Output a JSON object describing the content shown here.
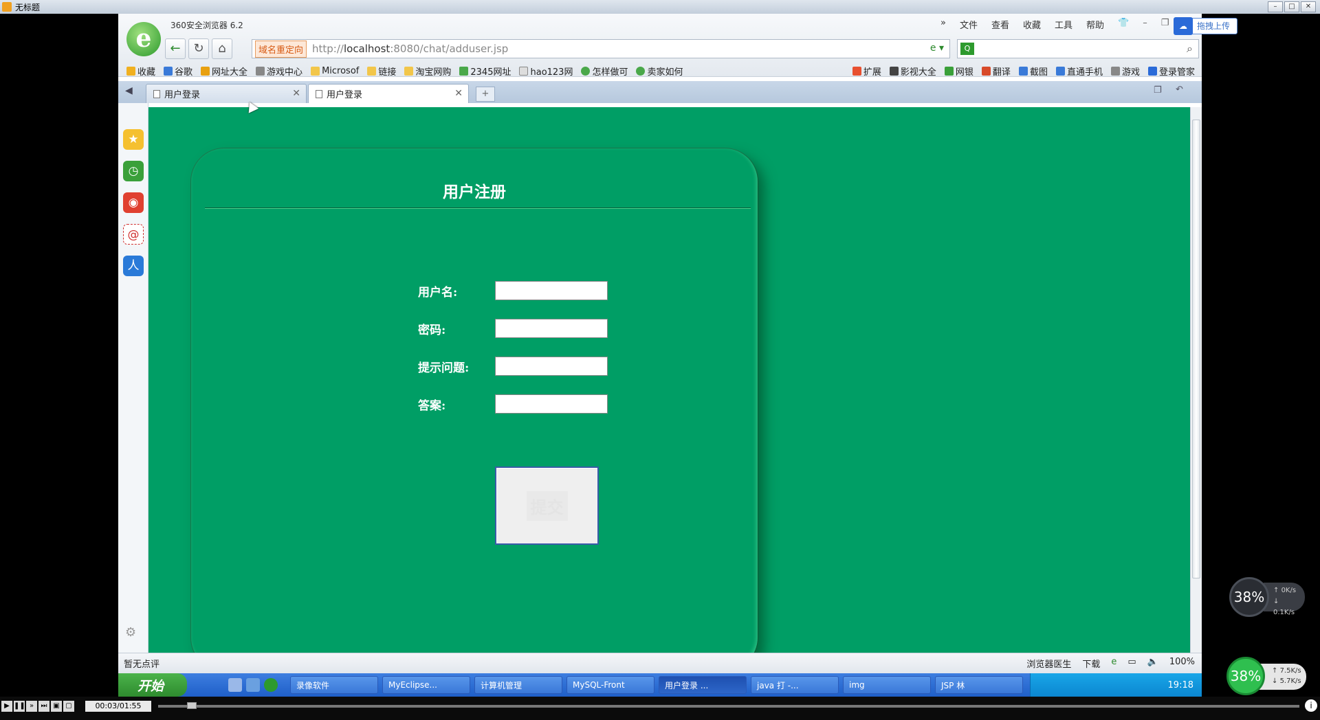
{
  "window": {
    "title": "无标题"
  },
  "browser": {
    "app_title": "360安全浏览器 6.2",
    "menu": [
      "»",
      "文件",
      "查看",
      "收藏",
      "工具",
      "帮助"
    ],
    "upload_label": "拖拽上传",
    "address": {
      "badge": "域名重定向",
      "url_prefix": "http://",
      "url_host": "localhost",
      "url_rest": ":8080/chat/adduser.jsp"
    },
    "favorites": [
      "收藏",
      "谷歌",
      "网址大全",
      "游戏中心",
      "Microsof",
      "链接",
      "淘宝网购",
      "2345网址",
      "hao123网",
      "怎样做可",
      "卖家如何"
    ],
    "favorites_right": [
      "扩展",
      "影视大全",
      "网银",
      "翻译",
      "截图",
      "直通手机",
      "游戏",
      "登录管家"
    ],
    "tabs": [
      {
        "label": "用户登录",
        "active": false
      },
      {
        "label": "用户登录",
        "active": true
      }
    ],
    "status": {
      "left": "暂无点评",
      "doctor": "浏览器医生",
      "download": "下载",
      "zoom": "100%"
    }
  },
  "page": {
    "title": "用户注册",
    "fields": [
      {
        "label": "用户名:",
        "value": ""
      },
      {
        "label": "密码:",
        "value": ""
      },
      {
        "label": "提示问题:",
        "value": ""
      },
      {
        "label": "答案:",
        "value": ""
      }
    ],
    "submit_label": "提交",
    "bg_color": "#009e65"
  },
  "taskbar": {
    "start_label": "开始",
    "tasks": [
      {
        "label": "录像软件",
        "active": false
      },
      {
        "label": "MyEclipse...",
        "active": false
      },
      {
        "label": "计算机管理",
        "active": false
      },
      {
        "label": "MySQL-Front",
        "active": false
      },
      {
        "label": "用户登录 ...",
        "active": true
      },
      {
        "label": "java 打 -...",
        "active": false
      },
      {
        "label": "img",
        "active": false
      },
      {
        "label": "JSP 林",
        "active": false
      }
    ],
    "clock": "19:18"
  },
  "player": {
    "time": "00:03/01:55"
  },
  "monitor": {
    "widget1": {
      "cpu": "38%",
      "up": "0K/s",
      "down": "0.1K/s"
    },
    "widget2": {
      "cpu": "38%",
      "up": "7.5K/s",
      "down": "5.7K/s"
    }
  }
}
